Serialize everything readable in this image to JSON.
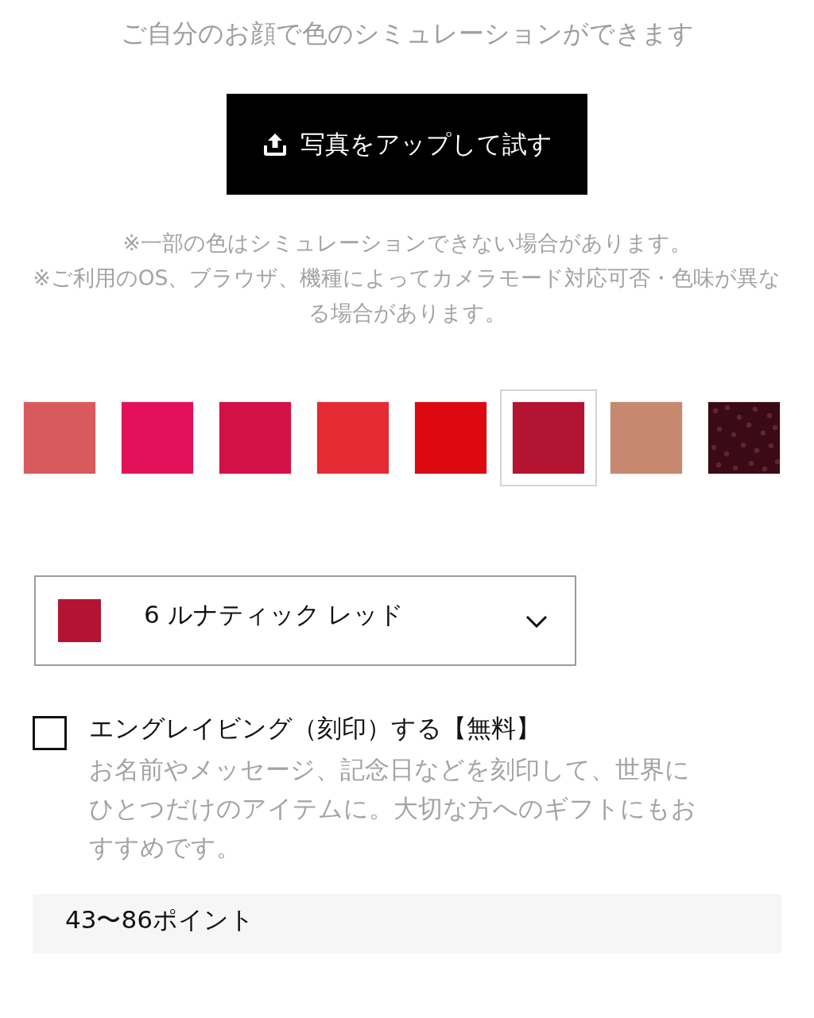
{
  "intro": {
    "text": "ご自分のお顔で色のシミュレーションができます"
  },
  "upload_button": {
    "label": "写真をアップして試す"
  },
  "notes": [
    "※一部の色はシミュレーションできない場合があります。",
    "※ご利用のOS、ブラウザ、機種によってカメラモード対応可否・色味が異なる場合があります。"
  ],
  "swatches": [
    {
      "kind": "solid",
      "color": "#d85a5d",
      "selected": false
    },
    {
      "kind": "solid",
      "color": "#e3105a",
      "selected": false
    },
    {
      "kind": "solid",
      "color": "#d41146",
      "selected": false
    },
    {
      "kind": "solid",
      "color": "#e42b33",
      "selected": false
    },
    {
      "kind": "solid",
      "color": "#dc0a10",
      "selected": false
    },
    {
      "kind": "solid",
      "color": "#b21432",
      "selected": true
    },
    {
      "kind": "solid",
      "color": "#c78870",
      "selected": false
    },
    {
      "kind": "glitter",
      "color": "#3a0a16",
      "selected": false
    }
  ],
  "shade_select": {
    "value": "6 ルナティック レッド",
    "color": "#b41432"
  },
  "engraving": {
    "checked": false,
    "label": "エングレイビング（刻印）する【無料】",
    "description": "お名前やメッセージ、記念日などを刻印して、世界にひとつだけのアイテムに。大切な方へのギフトにもおすすめです。"
  },
  "points": {
    "text": "43〜86ポイント"
  }
}
